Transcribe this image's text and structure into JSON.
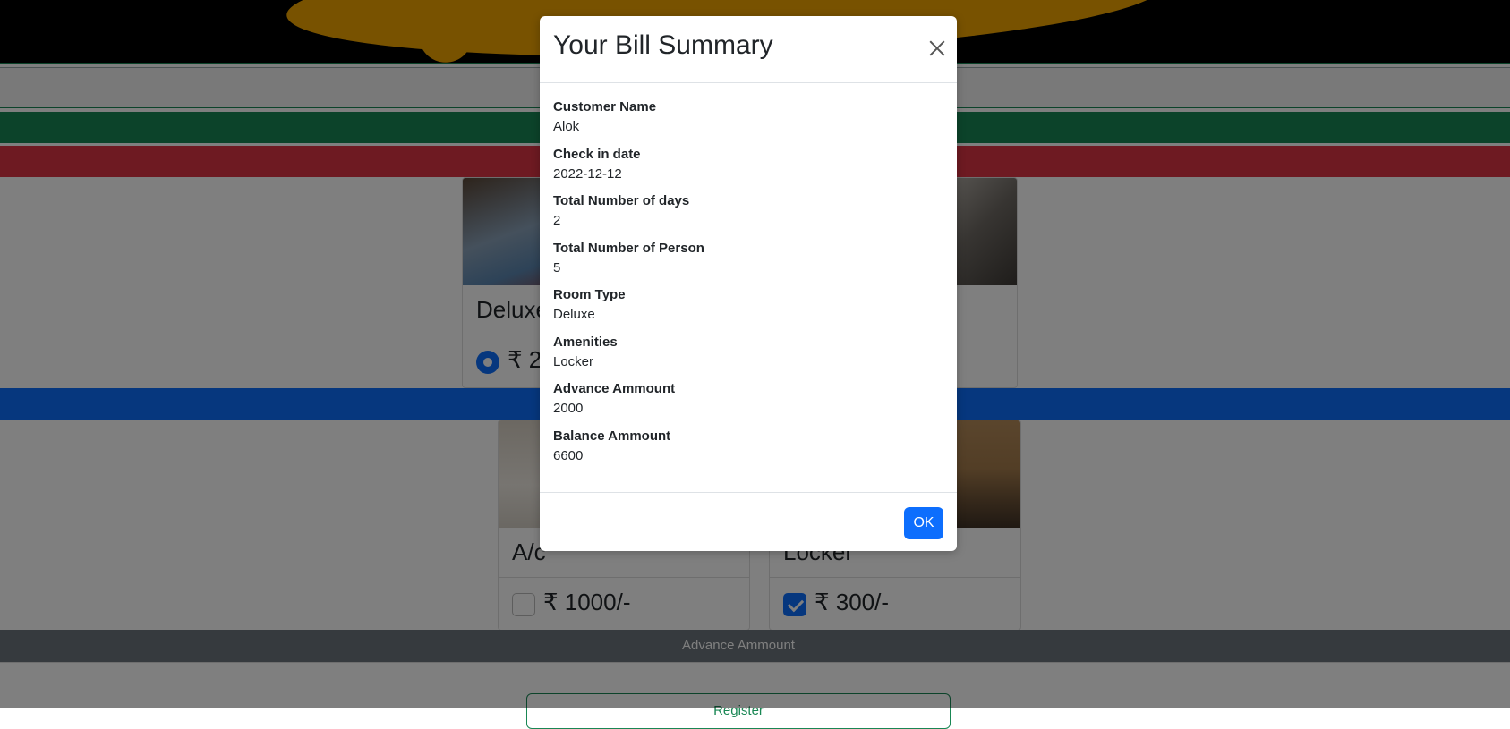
{
  "rooms": [
    {
      "title": "Deluxe",
      "price": "₹ 2",
      "selected": true
    },
    {
      "title": "",
      "price": "",
      "selected": false
    }
  ],
  "amenities": [
    {
      "title": "A/c",
      "price": "₹ 1000/-",
      "checked": false
    },
    {
      "title": "Locker",
      "price": "₹ 300/-",
      "checked": true
    }
  ],
  "form": {
    "advance_label": "Advance Ammount",
    "register_label": "Register"
  },
  "modal": {
    "title": "Your Bill Summary",
    "fields": [
      {
        "label": "Customer Name",
        "value": "Alok"
      },
      {
        "label": "Check in date",
        "value": "2022-12-12"
      },
      {
        "label": "Total Number of days",
        "value": "2"
      },
      {
        "label": "Total Number of Person",
        "value": "5"
      },
      {
        "label": "Room Type",
        "value": "Deluxe"
      },
      {
        "label": "Amenities",
        "value": "Locker"
      },
      {
        "label": "Advance Ammount",
        "value": "2000"
      },
      {
        "label": "Balance Ammount",
        "value": "6600"
      }
    ],
    "ok_label": "OK"
  },
  "colors": {
    "primary": "#0d6efd",
    "success": "#198754",
    "danger": "#dc3545",
    "secondary": "#6c757d",
    "brand_gold": "#f0a500"
  },
  "icons": {
    "close": "close-icon"
  }
}
